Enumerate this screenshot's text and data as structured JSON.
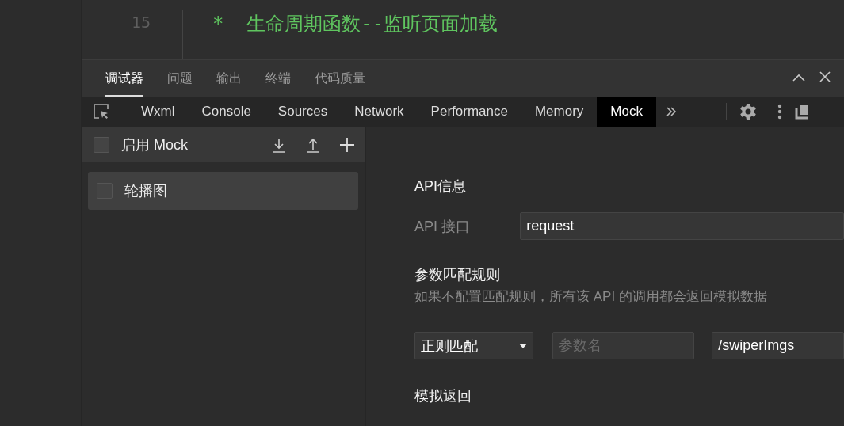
{
  "editor": {
    "line_number": "15",
    "code": "*  生命周期函数--监听页面加载"
  },
  "panel_tabs": [
    {
      "label": "调试器",
      "selected": true
    },
    {
      "label": "问题",
      "selected": false
    },
    {
      "label": "输出",
      "selected": false
    },
    {
      "label": "终端",
      "selected": false
    },
    {
      "label": "代码质量",
      "selected": false
    }
  ],
  "devtools_tabs": [
    {
      "label": "Wxml",
      "selected": false
    },
    {
      "label": "Console",
      "selected": false
    },
    {
      "label": "Sources",
      "selected": false
    },
    {
      "label": "Network",
      "selected": false
    },
    {
      "label": "Performance",
      "selected": false
    },
    {
      "label": "Memory",
      "selected": false
    },
    {
      "label": "Mock",
      "selected": true
    }
  ],
  "mock_sidebar": {
    "enable_label": "启用 Mock",
    "enabled": false,
    "rules": [
      {
        "name": "轮播图",
        "checked": false,
        "selected": true
      }
    ]
  },
  "api_info": {
    "title": "API信息",
    "interface_label": "API 接口",
    "interface_value": "request"
  },
  "param_rules": {
    "title": "参数匹配规则",
    "hint": "如果不配置匹配规则，所有该 API 的调用都会返回模拟数据",
    "match_type": "正则匹配",
    "param_name_placeholder": "参数名",
    "param_value": "/swiperImgs"
  },
  "mock_return": {
    "title": "模拟返回"
  }
}
